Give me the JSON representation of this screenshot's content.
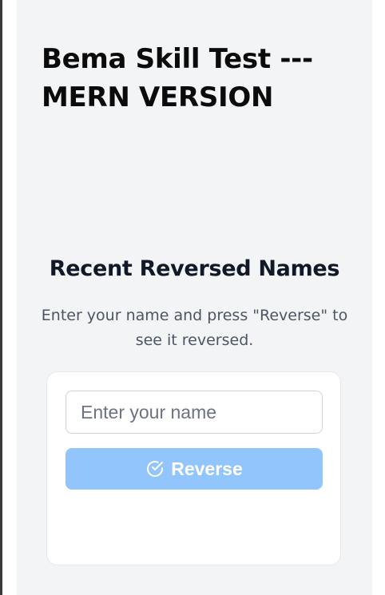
{
  "app": {
    "title": "Bema Skill Test --- MERN VERSION"
  },
  "section": {
    "title": "Recent Reversed Names",
    "instructions": "Enter your name and press \"Reverse\" to see it reversed."
  },
  "form": {
    "name_input": {
      "value": "",
      "placeholder": "Enter your name"
    },
    "reverse_button": {
      "label": "Reverse",
      "icon": "check-circle-icon"
    }
  },
  "colors": {
    "page_background": "#f3f4f6",
    "button_background": "#93c5fd",
    "title_text": "#111827",
    "body_text": "#4b5563"
  }
}
